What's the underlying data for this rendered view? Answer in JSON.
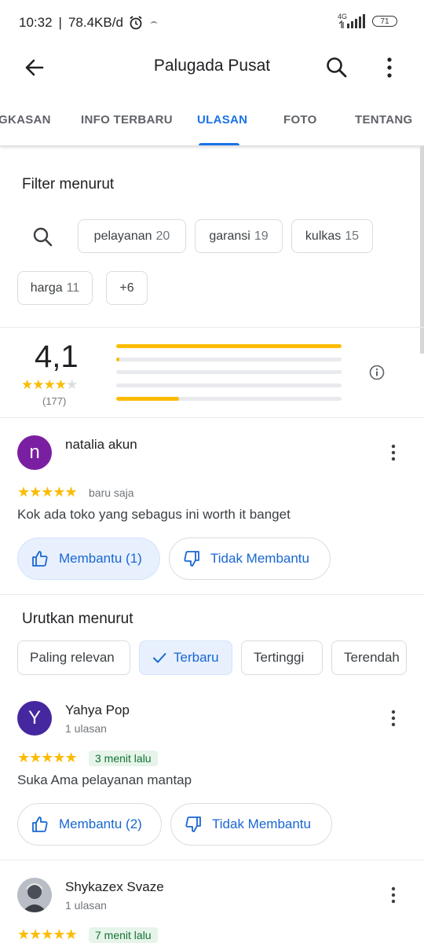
{
  "status_bar": {
    "time": "10:32",
    "separator": "|",
    "speed": "78.4KB/d",
    "network": "4G",
    "battery": "71"
  },
  "app_bar": {
    "title": "Palugada Pusat"
  },
  "tabs": [
    {
      "label": "GKASAN",
      "active": false
    },
    {
      "label": "INFO TERBARU",
      "active": false
    },
    {
      "label": "ULASAN",
      "active": true
    },
    {
      "label": "FOTO",
      "active": false
    },
    {
      "label": "TENTANG",
      "active": false
    }
  ],
  "filter": {
    "title": "Filter menurut",
    "chips": [
      {
        "label": "pelayanan",
        "count": "20"
      },
      {
        "label": "garansi",
        "count": "19"
      },
      {
        "label": "kulkas",
        "count": "15"
      },
      {
        "label": "harga",
        "count": "11"
      },
      {
        "label": "+6",
        "count": ""
      }
    ]
  },
  "summary": {
    "rating": "4,1",
    "stars": 4,
    "count": "(177)",
    "distribution": [
      {
        "stars": 5,
        "fraction": 1.0
      },
      {
        "stars": 4,
        "fraction": 0.015
      },
      {
        "stars": 3,
        "fraction": 0.0
      },
      {
        "stars": 2,
        "fraction": 0.0
      },
      {
        "stars": 1,
        "fraction": 0.28
      }
    ]
  },
  "review1": {
    "avatar_letter": "n",
    "avatar_color": "#7b1fa2",
    "name": "natalia akun",
    "stars": "★★★★★",
    "time": "baru saja",
    "text": "Kok ada toko yang sebagus ini worth it banget",
    "helpful": "Membantu (1)",
    "not_helpful": "Tidak Membantu"
  },
  "sort": {
    "title": "Urutkan menurut",
    "options": [
      {
        "label": "Paling relevan",
        "selected": false
      },
      {
        "label": "Terbaru",
        "selected": true
      },
      {
        "label": "Tertinggi",
        "selected": false
      },
      {
        "label": "Terendah",
        "selected": false
      }
    ]
  },
  "review2": {
    "avatar_letter": "Y",
    "avatar_color": "#4527a0",
    "name": "Yahya Pop",
    "sub": "1 ulasan",
    "stars": "★★★★★",
    "time": "3 menit lalu",
    "text": "Suka Ama pelayanan mantap",
    "helpful": "Membantu (2)",
    "not_helpful": "Tidak Membantu"
  },
  "review3": {
    "name": "Shykazex Svaze",
    "sub": "1 ulasan",
    "stars": "★★★★★",
    "time": "7 menit lalu"
  },
  "colors": {
    "accent": "#1a73e8",
    "star": "#fbbc04"
  }
}
